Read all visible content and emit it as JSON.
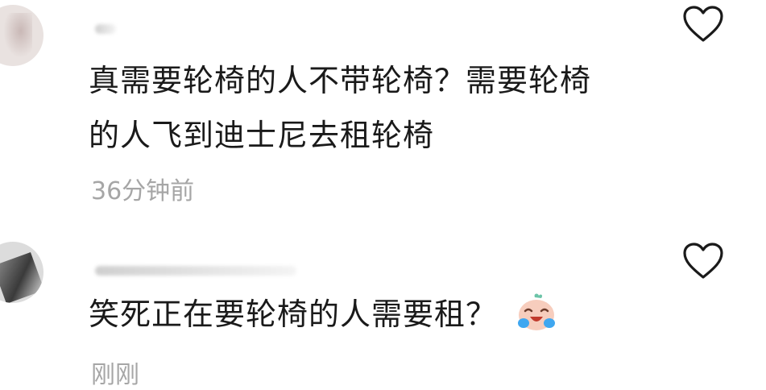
{
  "comments": [
    {
      "text": "真需要轮椅的人不带轮椅？需要轮椅的人飞到迪士尼去租轮椅",
      "time": "36分钟前"
    },
    {
      "text": "笑死正在要轮椅的人需要租？",
      "emoji": "laughing-crying-emoji",
      "time": "刚刚"
    }
  ],
  "icons": {
    "like": "heart-outline-icon"
  },
  "colors": {
    "text": "#1a1a1a",
    "timestamp": "#a6a6a6",
    "icon_stroke": "#1a1a1a",
    "background": "#ffffff"
  }
}
